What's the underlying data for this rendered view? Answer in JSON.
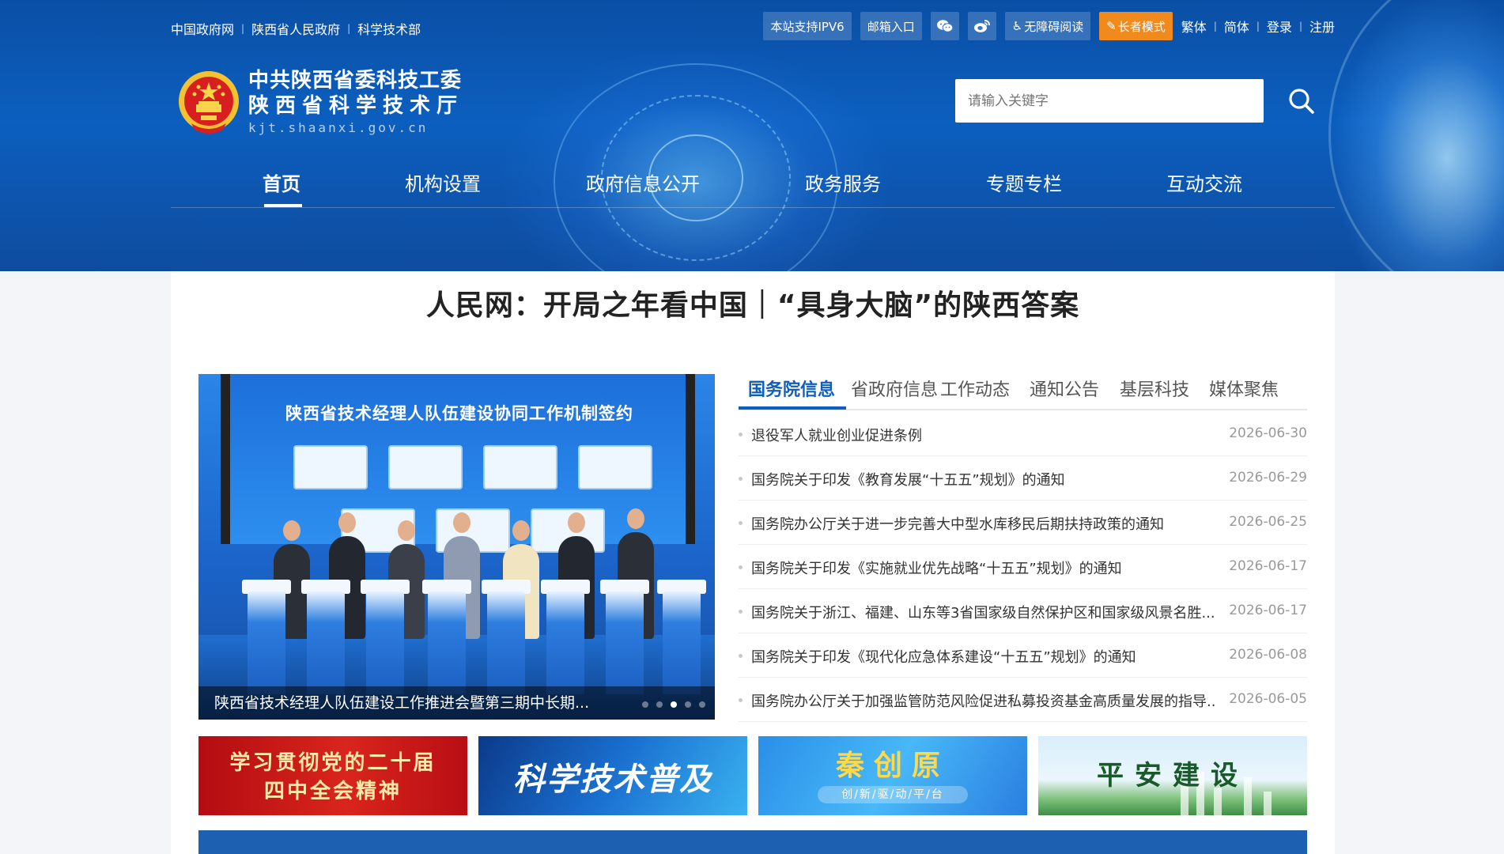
{
  "topbar": {
    "links": [
      "中国政府网",
      "陕西省人民政府",
      "科学技术部"
    ],
    "ipv6": "本站支持IPV6",
    "mailbox": "邮箱入口",
    "accessible": "无障碍阅读",
    "elder": "长者模式",
    "traditional": "繁体",
    "simplified": "简体",
    "login": "登录",
    "register": "注册"
  },
  "site": {
    "name_line1": "中共陕西省委科技工委",
    "name_line2": "陕西省科学技术厅",
    "url": "kjt.shaanxi.gov.cn"
  },
  "search": {
    "placeholder": "请输入关键字"
  },
  "nav": [
    "首页",
    "机构设置",
    "政府信息公开",
    "政务服务",
    "专题专栏",
    "互动交流"
  ],
  "headline": "人民网：开局之年看中国｜“具身大脑”的陕西答案",
  "slider": {
    "screen_title": "陕西省技术经理人队伍建设协同工作机制签约",
    "caption": "陕西省技术经理人队伍建设工作推进会暨第三期中长期..."
  },
  "tabs": [
    "国务院信息",
    "省政府信息",
    "工作动态",
    "通知公告",
    "基层科技",
    "媒体聚焦"
  ],
  "news": [
    {
      "title": "退役军人就业创业促进条例",
      "date": "2026-06-30"
    },
    {
      "title": "国务院关于印发《教育发展“十五五”规划》的通知",
      "date": "2026-06-29"
    },
    {
      "title": "国务院办公厅关于进一步完善大中型水库移民后期扶持政策的通知",
      "date": "2026-06-25"
    },
    {
      "title": "国务院关于印发《实施就业优先战略“十五五”规划》的通知",
      "date": "2026-06-17"
    },
    {
      "title": "国务院关于浙江、福建、山东等3省国家级自然保护区和国家级风景名胜...",
      "date": "2026-06-17"
    },
    {
      "title": "国务院关于印发《现代化应急体系建设“十五五”规划》的通知",
      "date": "2026-06-08"
    },
    {
      "title": "国务院办公厅关于加强监管防范风险促进私募投资基金高质量发展的指导...",
      "date": "2026-06-05"
    }
  ],
  "banners": {
    "b1_line1": "学习贯彻党的二十届",
    "b1_line2": "四中全会精神",
    "b2": "科学技术普及",
    "b3": "秦创原",
    "b3_sub": "创/新/驱/动/平/台",
    "b4": "平安建设"
  },
  "colors": {
    "header_blue": "#0c5fbf",
    "accent_blue": "#0d5fbf",
    "elder_orange": "#f08a1c"
  }
}
